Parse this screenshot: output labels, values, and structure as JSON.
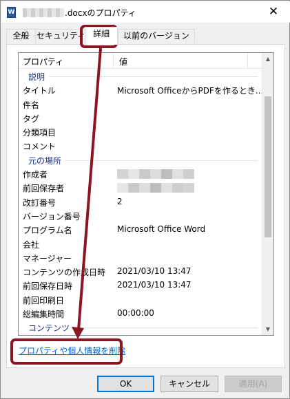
{
  "window": {
    "title_suffix": ".docxのプロパティ",
    "app_icon": "word-document-icon",
    "close_glyph": "✕"
  },
  "tabs": [
    {
      "label": "全般",
      "active": false
    },
    {
      "label": "セキュリティ",
      "active": false
    },
    {
      "label": "詳細",
      "active": true
    },
    {
      "label": "以前のバージョン",
      "active": false
    }
  ],
  "list": {
    "header": {
      "property": "プロパティ",
      "value": "値"
    },
    "rows": [
      {
        "type": "group",
        "name": "説明"
      },
      {
        "type": "item",
        "name": "タイトル",
        "value": "Microsoft OfficeからPDFを作るとき..."
      },
      {
        "type": "item",
        "name": "件名",
        "value": ""
      },
      {
        "type": "item",
        "name": "タグ",
        "value": ""
      },
      {
        "type": "item",
        "name": "分類項目",
        "value": ""
      },
      {
        "type": "item",
        "name": "コメント",
        "value": ""
      },
      {
        "type": "group",
        "name": "元の場所"
      },
      {
        "type": "item",
        "name": "作成者",
        "value": "",
        "redacted": true
      },
      {
        "type": "item",
        "name": "前回保存者",
        "value": "",
        "redacted": true
      },
      {
        "type": "item",
        "name": "改訂番号",
        "value": "2"
      },
      {
        "type": "item",
        "name": "バージョン番号",
        "value": ""
      },
      {
        "type": "item",
        "name": "プログラム名",
        "value": "Microsoft Office Word"
      },
      {
        "type": "item",
        "name": "会社",
        "value": ""
      },
      {
        "type": "item",
        "name": "マネージャー",
        "value": ""
      },
      {
        "type": "item",
        "name": "コンテンツの作成日時",
        "value": "2021/03/10 13:47"
      },
      {
        "type": "item",
        "name": "前回保存日時",
        "value": "2021/03/10 13:47"
      },
      {
        "type": "item",
        "name": "前回印刷日",
        "value": ""
      },
      {
        "type": "item",
        "name": "総編集時間",
        "value": "00:00:00"
      },
      {
        "type": "group",
        "name": "コンテンツ"
      }
    ]
  },
  "remove_link": "プロパティや個人情報を削除",
  "buttons": {
    "ok": "OK",
    "cancel": "キャンセル",
    "apply": "適用(A)"
  },
  "colors": {
    "annotation": "#8b1520",
    "link": "#0066cc",
    "focus": "#0078d7"
  }
}
